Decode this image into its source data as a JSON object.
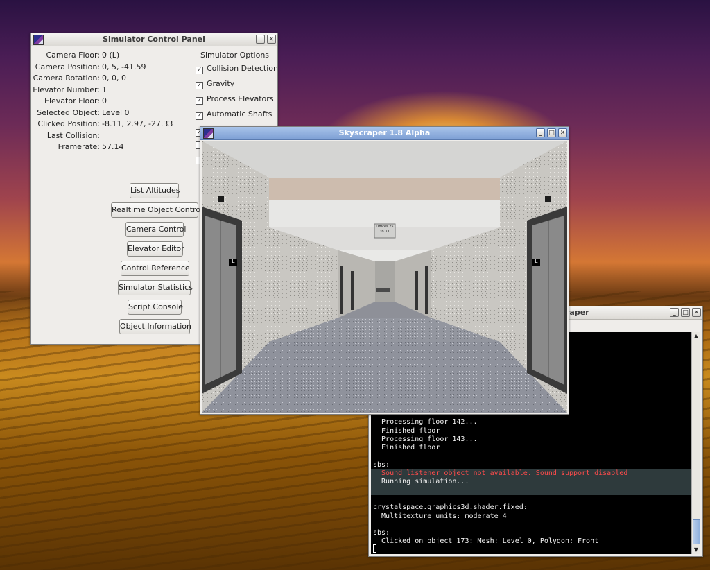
{
  "control_panel": {
    "title": "Simulator Control Panel",
    "info": [
      {
        "label": "Camera Floor:",
        "value": "0 (L)"
      },
      {
        "label": "Camera Position:",
        "value": "0, 5, -41.59"
      },
      {
        "label": "Camera Rotation:",
        "value": "0, 0, 0"
      },
      {
        "label": "Elevator Number:",
        "value": "1"
      },
      {
        "label": "Elevator Floor:",
        "value": "0"
      },
      {
        "label": "Selected Object:",
        "value": "Level 0"
      },
      {
        "label": "Clicked Position:",
        "value": "-8.11, 2.97, -27.33"
      },
      {
        "label": "Last Collision:",
        "value": ""
      },
      {
        "label": "Framerate:",
        "value": "57.14"
      }
    ],
    "options_title": "Simulator Options",
    "options": [
      {
        "label": "Collision Detection",
        "checked": true
      },
      {
        "label": "Gravity",
        "checked": true
      },
      {
        "label": "Process Elevators",
        "checked": true
      },
      {
        "label": "Automatic Shafts",
        "checked": true
      }
    ],
    "buttons": [
      "List Altitudes",
      "Realtime Object Control",
      "Camera Control",
      "Elevator Editor",
      "Control Reference",
      "Simulator Statistics",
      "Script Console",
      "Object Information"
    ]
  },
  "sky_window": {
    "title": "Skyscraper 1.8 Alpha",
    "sign_text": "Offices 25 to 33",
    "elevator_label": "L"
  },
  "console": {
    "title_partial": "raper",
    "lines": [
      {
        "text": "  Finished floor",
        "style": "normal"
      },
      {
        "text": "  Processing floor 142...",
        "style": "normal"
      },
      {
        "text": "  Finished floor",
        "style": "normal"
      },
      {
        "text": "  Processing floor 143...",
        "style": "normal"
      },
      {
        "text": "  Finished floor",
        "style": "normal"
      },
      {
        "text": "",
        "style": "normal"
      },
      {
        "text": "sbs:",
        "style": "normal"
      },
      {
        "text": "  Sound listener object not available. Sound support disabled",
        "style": "err"
      },
      {
        "text": "  Running simulation...",
        "style": "hl"
      },
      {
        "text": "",
        "style": "hl"
      },
      {
        "text": "",
        "style": "normal"
      },
      {
        "text": "crystalspace.graphics3d.shader.fixed:",
        "style": "normal"
      },
      {
        "text": "  Multitexture units: moderate 4",
        "style": "normal"
      },
      {
        "text": "",
        "style": "normal"
      },
      {
        "text": "sbs:",
        "style": "normal"
      },
      {
        "text": "  Clicked on object 173: Mesh: Level 0, Polygon: Front",
        "style": "normal"
      }
    ]
  },
  "colors": {
    "active_title": "#7d9fd4",
    "console_error": "#ff4b4b",
    "console_bg": "#000000"
  }
}
